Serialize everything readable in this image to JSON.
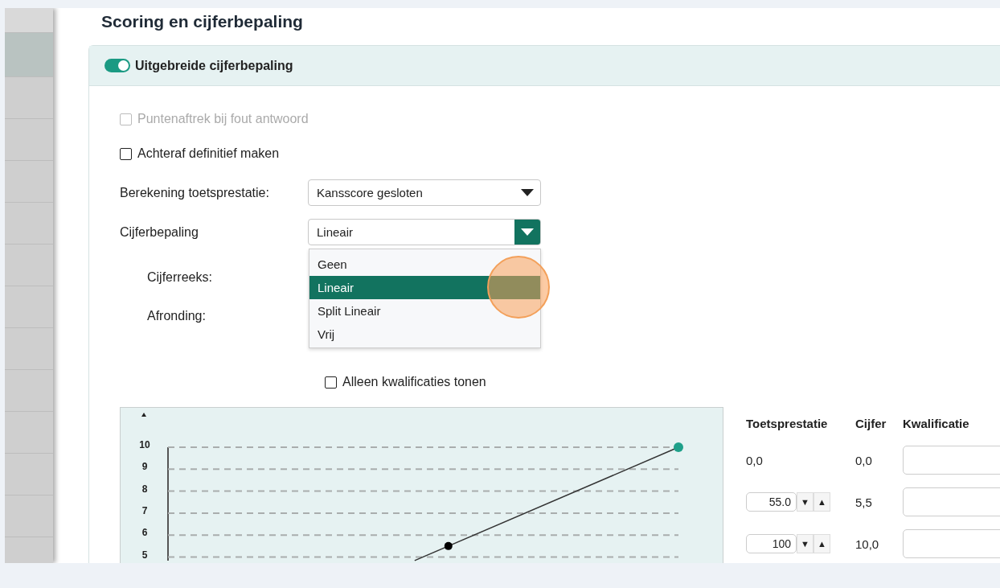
{
  "title": "Scoring en cijferbepaling",
  "panel": {
    "toggle": {
      "label": "Uitgebreide cijferbepaling",
      "on": true
    },
    "options": [
      {
        "label": "Puntenaftrek bij fout antwoord",
        "checked": false,
        "disabled": true
      },
      {
        "label": "Achteraf definitief maken",
        "checked": false,
        "disabled": false
      }
    ],
    "fields": [
      {
        "kind": "select",
        "label": "Berekening toetsprestatie:",
        "value": "Kansscore gesloten",
        "open": false
      },
      {
        "kind": "select",
        "label": "Cijferbepaling",
        "value": "Lineair",
        "open": true,
        "options": [
          {
            "label": "Geen",
            "selected": false
          },
          {
            "label": "Lineair",
            "selected": true
          },
          {
            "label": "Split Lineair",
            "selected": false
          },
          {
            "label": "Vrij",
            "selected": false
          }
        ]
      },
      {
        "kind": "sub",
        "label": "Cijferreeks:"
      },
      {
        "kind": "sub",
        "label": "Afronding:"
      }
    ],
    "sub_options": [
      {
        "label": "Alleen kwalificaties tonen",
        "checked": false,
        "disabled": false
      }
    ],
    "chart": {
      "kind": "picture",
      "tick_labels": [
        "10",
        "9",
        "8",
        "7",
        "6",
        "5"
      ]
    },
    "table": {
      "columns": [
        "Toetsprestatie",
        "Cijfer",
        "Kwalificatie"
      ],
      "rows": [
        {
          "kind": "fixed",
          "performance": "0,0",
          "grade": "0,0"
        },
        {
          "kind": "spinner",
          "performance": "55.0",
          "down": "▼",
          "up": "▲",
          "grade": "5,5"
        },
        {
          "kind": "spinner",
          "performance": "100",
          "down": "▼",
          "up": "▲",
          "grade": "10,0"
        }
      ]
    }
  }
}
